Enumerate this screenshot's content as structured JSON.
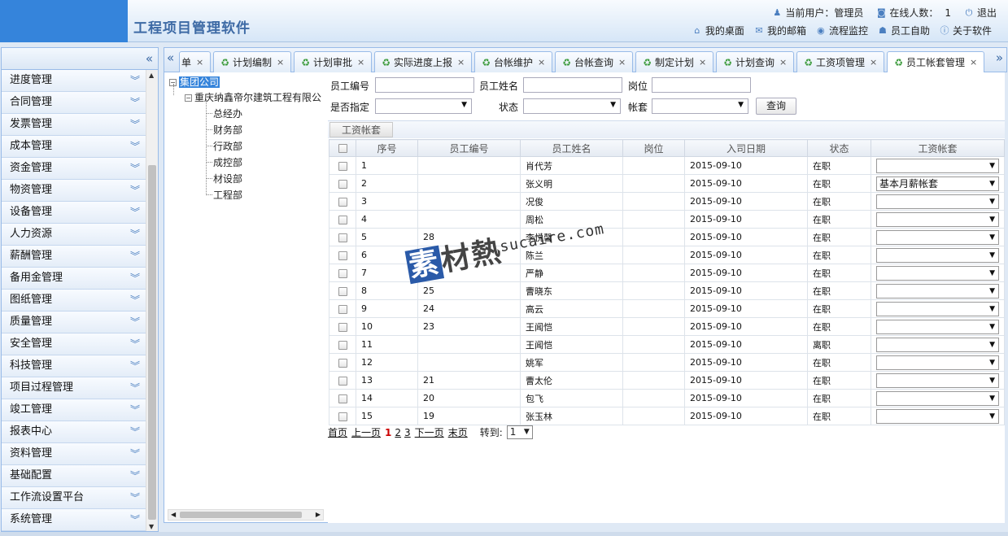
{
  "header": {
    "title": "工程项目管理软件",
    "current_user_label": "当前用户：管理员",
    "online_label": "在线人数：",
    "online_count": "1",
    "logout_label": "退出",
    "nav": [
      {
        "label": "我的桌面",
        "icon": "home-icon"
      },
      {
        "label": "我的邮箱",
        "icon": "mail-icon"
      },
      {
        "label": "流程监控",
        "icon": "monitor-icon"
      },
      {
        "label": "员工自助",
        "icon": "user-icon"
      },
      {
        "label": "关于软件",
        "icon": "info-icon"
      }
    ]
  },
  "sidebar": {
    "collapse_icon": "«",
    "items": [
      "进度管理",
      "合同管理",
      "发票管理",
      "成本管理",
      "资金管理",
      "物资管理",
      "设备管理",
      "人力资源",
      "薪酬管理",
      "备用金管理",
      "图纸管理",
      "质量管理",
      "安全管理",
      "科技管理",
      "项目过程管理",
      "竣工管理",
      "报表中心",
      "资料管理",
      "基础配置",
      "工作流设置平台",
      "系统管理"
    ]
  },
  "tabs": [
    {
      "label": "单",
      "icon": false,
      "active": false,
      "partial": true
    },
    {
      "label": "计划编制",
      "icon": true,
      "active": false
    },
    {
      "label": "计划审批",
      "icon": true,
      "active": false
    },
    {
      "label": "实际进度上报",
      "icon": true,
      "active": false
    },
    {
      "label": "台帐维护",
      "icon": true,
      "active": false
    },
    {
      "label": "台帐查询",
      "icon": true,
      "active": false
    },
    {
      "label": "制定计划",
      "icon": true,
      "active": false
    },
    {
      "label": "计划查询",
      "icon": true,
      "active": false
    },
    {
      "label": "工资项管理",
      "icon": true,
      "active": false
    },
    {
      "label": "员工帐套管理",
      "icon": true,
      "active": true
    }
  ],
  "tree": {
    "root": "集团公司",
    "company": "重庆纳鑫帝尔建筑工程有限公",
    "departments": [
      "总经办",
      "财务部",
      "行政部",
      "成控部",
      "材设部",
      "工程部"
    ]
  },
  "search": {
    "employee_no_label": "员工编号",
    "employee_no_value": "",
    "employee_name_label": "员工姓名",
    "employee_name_value": "",
    "position_label": "岗位",
    "position_value": "",
    "assigned_label": "是否指定",
    "assigned_value": "",
    "status_label": "状态",
    "status_value": "",
    "account_set_label": "帐套",
    "account_set_value": "",
    "query_button": "查询"
  },
  "toolbar": {
    "button": "工资帐套"
  },
  "grid": {
    "columns": [
      "",
      "序号",
      "员工编号",
      "员工姓名",
      "岗位",
      "入司日期",
      "状态",
      "工资帐套"
    ],
    "rows": [
      {
        "seq": "1",
        "emp_no": "",
        "name": "肖代芳",
        "position": "",
        "date": "2015-09-10",
        "status": "在职",
        "account_set": ""
      },
      {
        "seq": "2",
        "emp_no": "",
        "name": "张义明",
        "position": "",
        "date": "2015-09-10",
        "status": "在职",
        "account_set": "基本月薪帐套"
      },
      {
        "seq": "3",
        "emp_no": "",
        "name": "况俊",
        "position": "",
        "date": "2015-09-10",
        "status": "在职",
        "account_set": ""
      },
      {
        "seq": "4",
        "emp_no": "",
        "name": "周松",
        "position": "",
        "date": "2015-09-10",
        "status": "在职",
        "account_set": ""
      },
      {
        "seq": "5",
        "emp_no": "28",
        "name": "李悦馨",
        "position": "",
        "date": "2015-09-10",
        "status": "在职",
        "account_set": ""
      },
      {
        "seq": "6",
        "emp_no": "",
        "name": "陈兰",
        "position": "",
        "date": "2015-09-10",
        "status": "在职",
        "account_set": ""
      },
      {
        "seq": "7",
        "emp_no": "",
        "name": "严静",
        "position": "",
        "date": "2015-09-10",
        "status": "在职",
        "account_set": ""
      },
      {
        "seq": "8",
        "emp_no": "25",
        "name": "曹晓东",
        "position": "",
        "date": "2015-09-10",
        "status": "在职",
        "account_set": ""
      },
      {
        "seq": "9",
        "emp_no": "24",
        "name": "高云",
        "position": "",
        "date": "2015-09-10",
        "status": "在职",
        "account_set": ""
      },
      {
        "seq": "10",
        "emp_no": "23",
        "name": "王闻恺",
        "position": "",
        "date": "2015-09-10",
        "status": "在职",
        "account_set": ""
      },
      {
        "seq": "11",
        "emp_no": "",
        "name": "王闻恺",
        "position": "",
        "date": "2015-09-10",
        "status": "离职",
        "account_set": ""
      },
      {
        "seq": "12",
        "emp_no": "",
        "name": "姚军",
        "position": "",
        "date": "2015-09-10",
        "status": "在职",
        "account_set": ""
      },
      {
        "seq": "13",
        "emp_no": "21",
        "name": "曹太伦",
        "position": "",
        "date": "2015-09-10",
        "status": "在职",
        "account_set": ""
      },
      {
        "seq": "14",
        "emp_no": "20",
        "name": "包飞",
        "position": "",
        "date": "2015-09-10",
        "status": "在职",
        "account_set": ""
      },
      {
        "seq": "15",
        "emp_no": "19",
        "name": "张玉林",
        "position": "",
        "date": "2015-09-10",
        "status": "在职",
        "account_set": ""
      }
    ]
  },
  "pager": {
    "first": "首页",
    "prev": "上一页",
    "pages": [
      "1",
      "2",
      "3"
    ],
    "current": "1",
    "next": "下一页",
    "last": "末页",
    "goto_label": "转到:",
    "goto_value": "1"
  },
  "watermark": {
    "main": "素材熱",
    "sub": "sucaire.com"
  },
  "colors": {
    "accent": "#3584db",
    "title": "#3d6aa5",
    "border": "#99bbe8"
  }
}
